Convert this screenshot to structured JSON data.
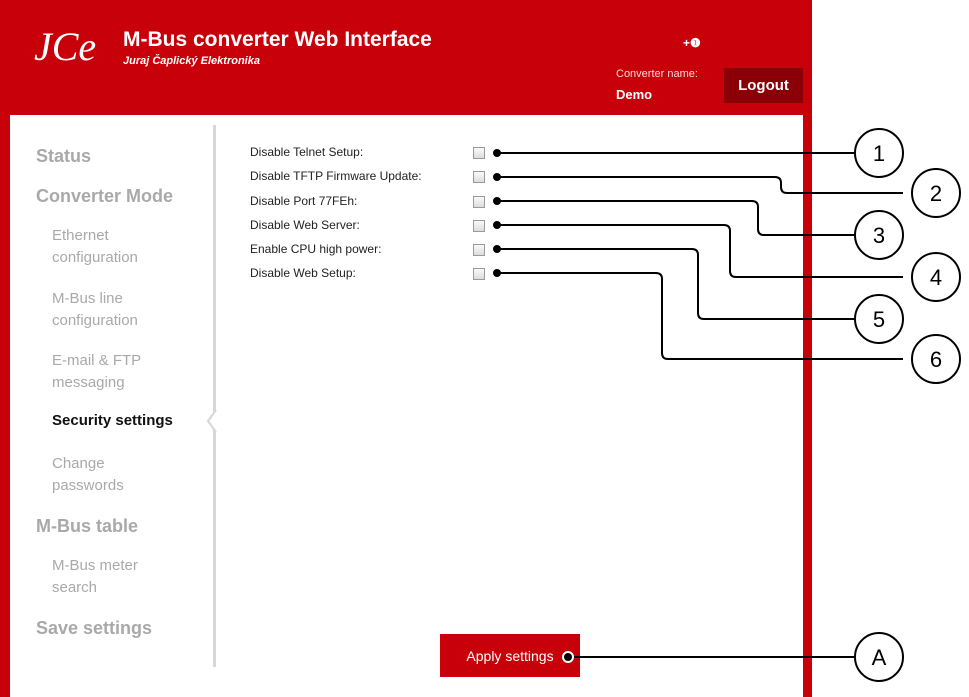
{
  "header": {
    "title": "M-Bus converter Web Interface",
    "company": "Juraj Čaplický Elektronika",
    "logo_text": "JCe",
    "info_label": "+❶",
    "converter_name_label": "Converter name:",
    "converter_name_value": "Demo",
    "logout_label": "Logout"
  },
  "sidebar": {
    "status": "Status",
    "converter_mode": "Converter Mode",
    "ethernet": "Ethernet configuration",
    "mbus_line": "M-Bus line configuration",
    "email_ftp": "E-mail & FTP messaging",
    "security": "Security settings",
    "change_passwords": "Change passwords",
    "mbus_table": "M-Bus table",
    "meter_search": "M-Bus meter search",
    "save_settings": "Save settings"
  },
  "settings": {
    "rows": [
      {
        "label": "Disable Telnet Setup:",
        "checked": false
      },
      {
        "label": "Disable TFTP Firmware Update:",
        "checked": false
      },
      {
        "label": "Disable Port 77FEh:",
        "checked": false
      },
      {
        "label": "Disable Web Server:",
        "checked": false
      },
      {
        "label": "Enable CPU high power:",
        "checked": false
      },
      {
        "label": "Disable Web Setup:",
        "checked": false
      }
    ],
    "apply_label": "Apply settings"
  },
  "callouts": [
    "1",
    "2",
    "3",
    "4",
    "5",
    "6",
    "A"
  ],
  "colors": {
    "brand_red": "#c8000a",
    "dark_red": "#8b0006",
    "inactive_nav": "#a9a9a9"
  }
}
